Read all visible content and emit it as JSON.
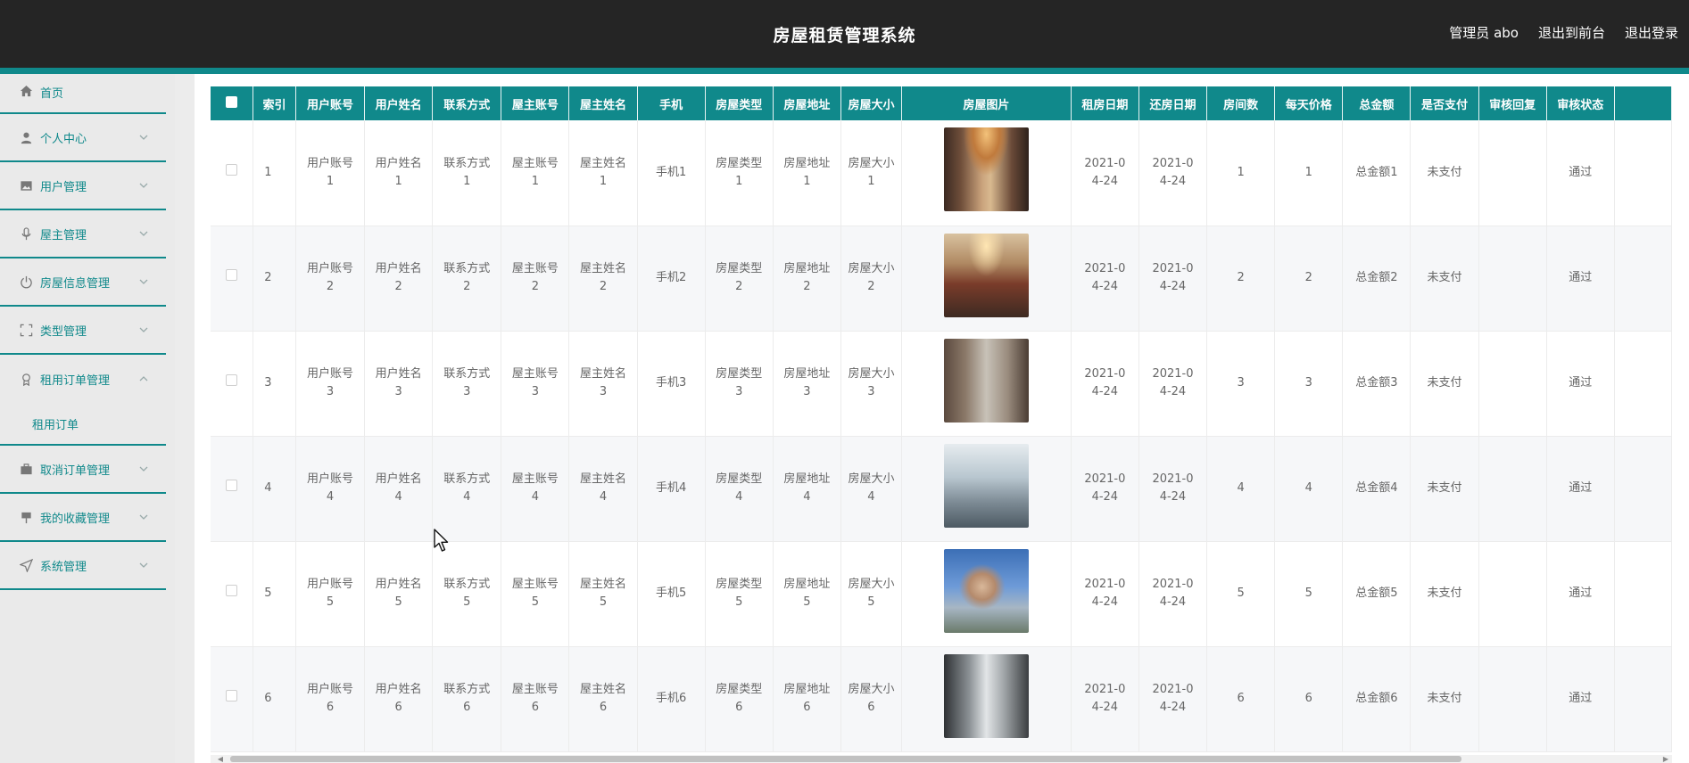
{
  "header": {
    "title": "房屋租赁管理系统",
    "links": [
      "管理员 abo",
      "退出到前台",
      "退出登录"
    ]
  },
  "sidebar": {
    "items": [
      {
        "label": "首页",
        "icon": "home-icon"
      },
      {
        "label": "个人中心",
        "icon": "user-icon"
      },
      {
        "label": "用户管理",
        "icon": "image-icon"
      },
      {
        "label": "屋主管理",
        "icon": "microphone-icon"
      },
      {
        "label": "房屋信息管理",
        "icon": "power-icon"
      },
      {
        "label": "类型管理",
        "icon": "fullscreen-icon"
      },
      {
        "label": "租用订单管理",
        "icon": "badge-icon",
        "expanded": true,
        "children": [
          "租用订单"
        ]
      },
      {
        "label": "取消订单管理",
        "icon": "briefcase-icon"
      },
      {
        "label": "我的收藏管理",
        "icon": "flag-icon"
      },
      {
        "label": "系统管理",
        "icon": "send-icon"
      }
    ]
  },
  "table": {
    "headers": [
      "索引",
      "用户账号",
      "用户姓名",
      "联系方式",
      "屋主账号",
      "屋主姓名",
      "手机",
      "房屋类型",
      "房屋地址",
      "房屋大小",
      "房屋图片",
      "租房日期",
      "还房日期",
      "房间数",
      "每天价格",
      "总金额",
      "是否支付",
      "审核回复",
      "审核状态"
    ],
    "rows": [
      {
        "idx": "1",
        "user_account": "用户账号1",
        "user_name": "用户姓名1",
        "contact": "联系方式1",
        "owner_account": "屋主账号1",
        "owner_name": "屋主姓名1",
        "phone": "手机1",
        "house_type": "房屋类型1",
        "house_address": "房屋地址1",
        "house_size": "房屋大小1",
        "photo": "photo-1",
        "rent_date": "2021-04-24",
        "return_date": "2021-04-24",
        "rooms": "1",
        "daily_price": "1",
        "total": "总金额1",
        "paid": "未支付",
        "review_reply": "",
        "review_status": "通过"
      },
      {
        "idx": "2",
        "user_account": "用户账号2",
        "user_name": "用户姓名2",
        "contact": "联系方式2",
        "owner_account": "屋主账号2",
        "owner_name": "屋主姓名2",
        "phone": "手机2",
        "house_type": "房屋类型2",
        "house_address": "房屋地址2",
        "house_size": "房屋大小2",
        "photo": "photo-2",
        "rent_date": "2021-04-24",
        "return_date": "2021-04-24",
        "rooms": "2",
        "daily_price": "2",
        "total": "总金额2",
        "paid": "未支付",
        "review_reply": "",
        "review_status": "通过"
      },
      {
        "idx": "3",
        "user_account": "用户账号3",
        "user_name": "用户姓名3",
        "contact": "联系方式3",
        "owner_account": "屋主账号3",
        "owner_name": "屋主姓名3",
        "phone": "手机3",
        "house_type": "房屋类型3",
        "house_address": "房屋地址3",
        "house_size": "房屋大小3",
        "photo": "photo-3",
        "rent_date": "2021-04-24",
        "return_date": "2021-04-24",
        "rooms": "3",
        "daily_price": "3",
        "total": "总金额3",
        "paid": "未支付",
        "review_reply": "",
        "review_status": "通过"
      },
      {
        "idx": "4",
        "user_account": "用户账号4",
        "user_name": "用户姓名4",
        "contact": "联系方式4",
        "owner_account": "屋主账号4",
        "owner_name": "屋主姓名4",
        "phone": "手机4",
        "house_type": "房屋类型4",
        "house_address": "房屋地址4",
        "house_size": "房屋大小4",
        "photo": "photo-4",
        "rent_date": "2021-04-24",
        "return_date": "2021-04-24",
        "rooms": "4",
        "daily_price": "4",
        "total": "总金额4",
        "paid": "未支付",
        "review_reply": "",
        "review_status": "通过"
      },
      {
        "idx": "5",
        "user_account": "用户账号5",
        "user_name": "用户姓名5",
        "contact": "联系方式5",
        "owner_account": "屋主账号5",
        "owner_name": "屋主姓名5",
        "phone": "手机5",
        "house_type": "房屋类型5",
        "house_address": "房屋地址5",
        "house_size": "房屋大小5",
        "photo": "photo-5",
        "rent_date": "2021-04-24",
        "return_date": "2021-04-24",
        "rooms": "5",
        "daily_price": "5",
        "total": "总金额5",
        "paid": "未支付",
        "review_reply": "",
        "review_status": "通过"
      },
      {
        "idx": "6",
        "user_account": "用户账号6",
        "user_name": "用户姓名6",
        "contact": "联系方式6",
        "owner_account": "屋主账号6",
        "owner_name": "屋主姓名6",
        "phone": "手机6",
        "house_type": "房屋类型6",
        "house_address": "房屋地址6",
        "house_size": "房屋大小6",
        "photo": "photo-6",
        "rent_date": "2021-04-24",
        "return_date": "2021-04-24",
        "rooms": "6",
        "daily_price": "6",
        "total": "总金额6",
        "paid": "未支付",
        "review_reply": "",
        "review_status": "通过"
      }
    ]
  },
  "colors": {
    "accent": "#10898b",
    "header_bg": "#252525",
    "sidebar_bg": "#eaeaea"
  }
}
